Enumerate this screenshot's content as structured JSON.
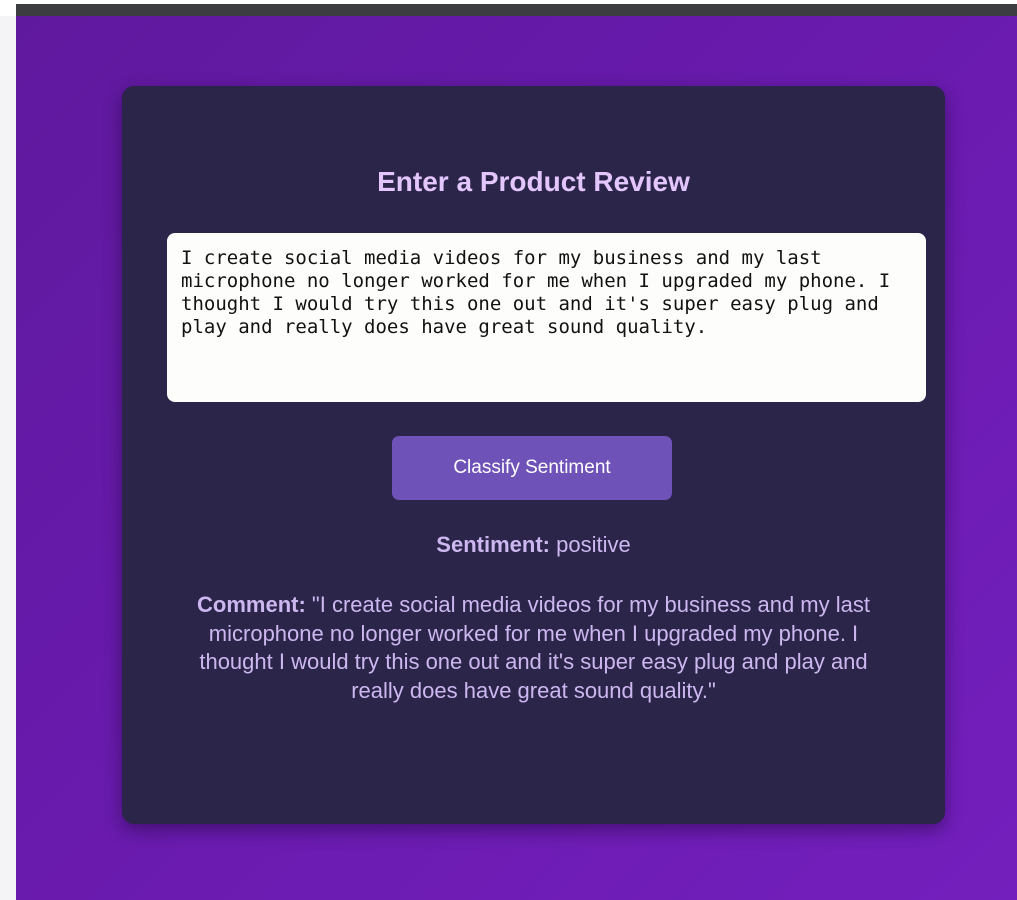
{
  "form": {
    "title": "Enter a Product Review",
    "review_text": "I create social media videos for my business and my last microphone no longer worked for me when I upgraded my phone. I thought I would try this one out and it's super easy plug and play and really does have great sound quality.",
    "classify_button_label": "Classify Sentiment"
  },
  "result": {
    "sentiment_label": "Sentiment:",
    "sentiment_value": "positive",
    "comment_label": "Comment:",
    "comment_value": "\"I create social media videos for my business and my last microphone no longer worked for me when I upgraded my phone. I thought I would try this one out and it's super easy plug and play and really does have great sound quality.\""
  },
  "colors": {
    "background_gradient_start": "#5f199e",
    "background_gradient_end": "#731fbd",
    "card": "#2b2549",
    "title": "#e4c6ff",
    "button": "#6e52b7",
    "result_text": "#cdb7f0"
  }
}
